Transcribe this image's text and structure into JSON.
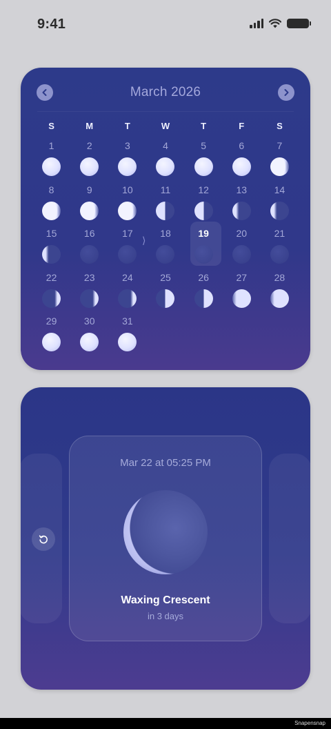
{
  "status_bar": {
    "time": "9:41"
  },
  "calendar": {
    "title": "March 2026",
    "weekdays": [
      "S",
      "M",
      "T",
      "W",
      "T",
      "F",
      "S"
    ],
    "today": 19,
    "days": [
      {
        "day": 1,
        "phase": "full"
      },
      {
        "day": 2,
        "phase": "full"
      },
      {
        "day": 3,
        "phase": "full"
      },
      {
        "day": 4,
        "phase": "full"
      },
      {
        "day": 5,
        "phase": "full"
      },
      {
        "day": 6,
        "phase": "full"
      },
      {
        "day": 7,
        "phase": "waning-gibbous"
      },
      {
        "day": 8,
        "phase": "waning-gibbous"
      },
      {
        "day": 9,
        "phase": "waning-gibbous"
      },
      {
        "day": 10,
        "phase": "waning-gibbous"
      },
      {
        "day": 11,
        "phase": "last-quarter"
      },
      {
        "day": 12,
        "phase": "last-quarter"
      },
      {
        "day": 13,
        "phase": "waning-crescent"
      },
      {
        "day": 14,
        "phase": "waning-crescent"
      },
      {
        "day": 15,
        "phase": "waning-crescent"
      },
      {
        "day": 16,
        "phase": "new"
      },
      {
        "day": 17,
        "phase": "new"
      },
      {
        "day": 18,
        "phase": "new"
      },
      {
        "day": 19,
        "phase": "new"
      },
      {
        "day": 20,
        "phase": "new"
      },
      {
        "day": 21,
        "phase": "new"
      },
      {
        "day": 22,
        "phase": "waxing-crescent"
      },
      {
        "day": 23,
        "phase": "waxing-crescent"
      },
      {
        "day": 24,
        "phase": "waxing-crescent"
      },
      {
        "day": 25,
        "phase": "first-quarter"
      },
      {
        "day": 26,
        "phase": "first-quarter"
      },
      {
        "day": 27,
        "phase": "waxing-gibbous"
      },
      {
        "day": 28,
        "phase": "waxing-gibbous"
      },
      {
        "day": 29,
        "phase": "full"
      },
      {
        "day": 30,
        "phase": "full"
      },
      {
        "day": 31,
        "phase": "full"
      }
    ]
  },
  "detail": {
    "datetime": "Mar 22 at 05:25 PM",
    "phase_name": "Waxing Crescent",
    "subtitle": "in 3 days"
  },
  "footer": {
    "watermark": "Snapensnap"
  },
  "colors": {
    "panel_top": "#2d3a8a",
    "panel_bottom": "#4a3a8e",
    "moon_light": "#dfe2ff",
    "moon_dark": "#3c4590"
  }
}
